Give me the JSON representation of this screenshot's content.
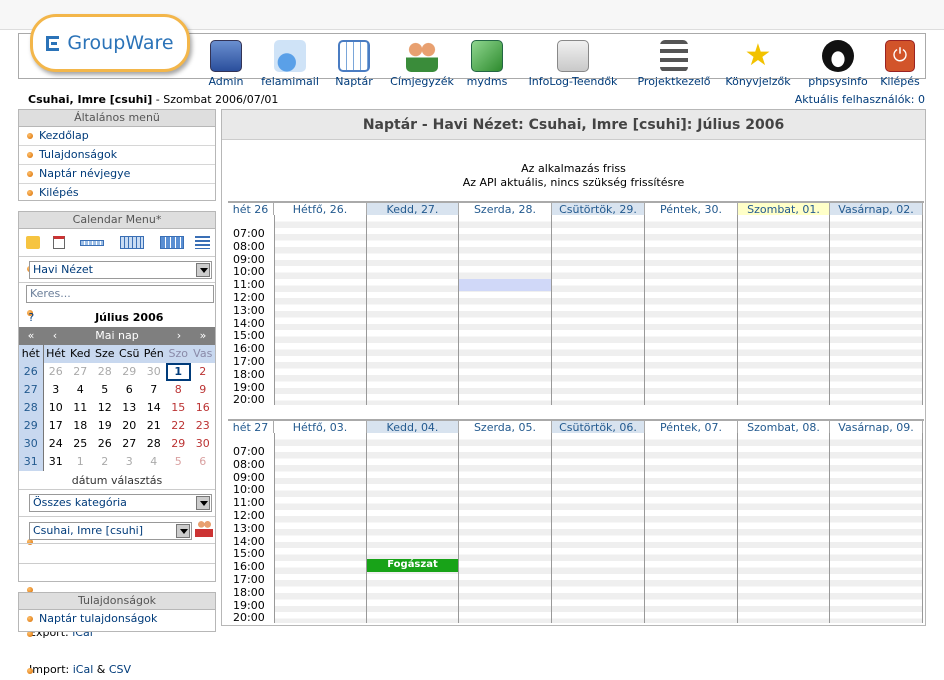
{
  "app": {
    "logo_text": "GroupWare"
  },
  "nav": [
    {
      "label": "Admin",
      "icon": "admin-icon"
    },
    {
      "label": "felamimail",
      "icon": "mail-icon"
    },
    {
      "label": "Naptár",
      "icon": "calendar-icon"
    },
    {
      "label": "Címjegyzék",
      "icon": "addressbook-icon"
    },
    {
      "label": "mydms",
      "icon": "dms-icon"
    },
    {
      "label": "InfoLog-Teendők",
      "icon": "infolog-icon"
    },
    {
      "label": "Projektkezelő",
      "icon": "project-icon"
    },
    {
      "label": "Könyvjelzők",
      "icon": "star-icon"
    },
    {
      "label": "phpsysinfo",
      "icon": "penguin-icon"
    },
    {
      "label": "Kilépés",
      "icon": "power-icon"
    }
  ],
  "user": {
    "name": "Csuhai, Imre [csuhi]",
    "date": " - Szombat 2006/07/01",
    "current_users": "Aktuális felhasználók: 0"
  },
  "general_menu": {
    "title": "Általános menü",
    "items": [
      "Kezdőlap",
      "Tulajdonságok",
      "Naptár névjegye",
      "Kilépés"
    ]
  },
  "calendar_menu": {
    "title": "Calendar Menu*",
    "view_select": "Havi Nézet",
    "search_placeholder": "Keres...",
    "minical": {
      "help": "?",
      "month": "Július 2006",
      "nav": [
        "«",
        "‹",
        "Mai nap",
        "›",
        "»"
      ],
      "weekdays": [
        "hét",
        "Hét",
        "Ked",
        "Sze",
        "Csü",
        "Pén",
        "Szo",
        "Vas"
      ],
      "weeks": [
        [
          "26",
          "26",
          "27",
          "28",
          "29",
          "30",
          "1",
          "2"
        ],
        [
          "27",
          "3",
          "4",
          "5",
          "6",
          "7",
          "8",
          "9"
        ],
        [
          "28",
          "10",
          "11",
          "12",
          "13",
          "14",
          "15",
          "16"
        ],
        [
          "29",
          "17",
          "18",
          "19",
          "20",
          "21",
          "22",
          "23"
        ],
        [
          "30",
          "24",
          "25",
          "26",
          "27",
          "28",
          "29",
          "30"
        ],
        [
          "31",
          "31",
          "1",
          "2",
          "3",
          "4",
          "5",
          "6"
        ]
      ],
      "date_pick": "dátum választás"
    },
    "category_select": "Összes kategória",
    "user_select": "Csuhai, Imre [csuhi]",
    "export": {
      "label": "Export:",
      "link": "iCal"
    },
    "import": {
      "label": "Import:",
      "link1": "iCal",
      "amp": "&",
      "link2": "CSV"
    }
  },
  "properties_box": {
    "title": "Tulajdonságok",
    "items": [
      "Naptár tulajdonságok"
    ]
  },
  "main": {
    "title": "Naptár - Havi Nézet: Csuhai, Imre [csuhi]: Július 2006",
    "msg1": "Az alkalmazás friss",
    "msg2": "Az API aktuális, nincs szükség frissítésre",
    "times": [
      "07:00",
      "08:00",
      "09:00",
      "10:00",
      "11:00",
      "12:00",
      "13:00",
      "14:00",
      "15:00",
      "16:00",
      "17:00",
      "18:00",
      "19:00",
      "20:00"
    ],
    "weeks": [
      {
        "label": "hét 26",
        "days": [
          "Hétfő, 26.",
          "Kedd, 27.",
          "Szerda, 28.",
          "Csütörtök, 29.",
          "Péntek, 30.",
          "Szombat, 01.",
          "Vasárnap, 02."
        ]
      },
      {
        "label": "hét 27",
        "days": [
          "Hétfő, 03.",
          "Kedd, 04.",
          "Szerda, 05.",
          "Csütörtök, 06.",
          "Péntek, 07.",
          "Szombat, 08.",
          "Vasárnap, 09."
        ]
      }
    ],
    "event": {
      "title": "Fogászat",
      "week": 1,
      "day": 1,
      "time": "16:00"
    }
  },
  "colors": {
    "link": "#003b7a",
    "event": "#18a318",
    "today": "#ffffc8",
    "header_bg": "#dedede"
  }
}
